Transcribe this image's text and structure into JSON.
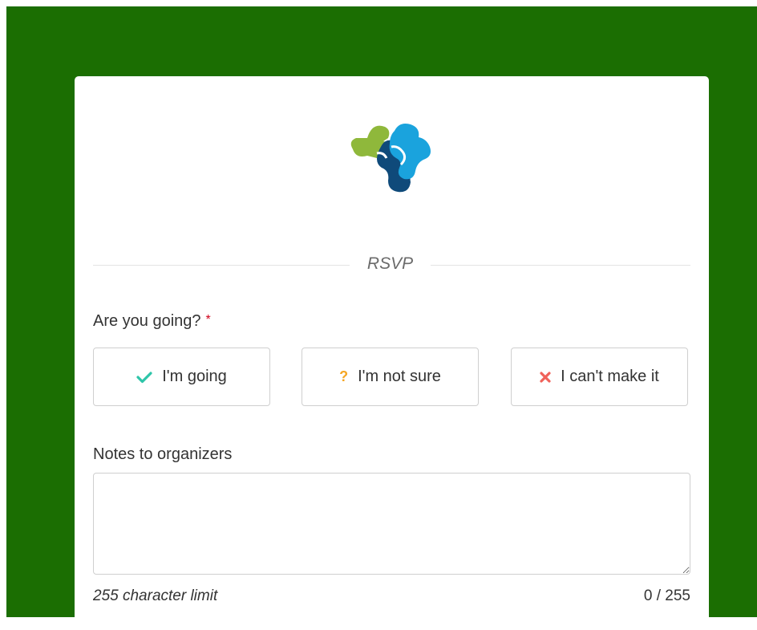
{
  "theme": {
    "background": "#1b6e02",
    "card": "#ffffff",
    "check_color": "#2ec5a9",
    "question_color": "#f5a623",
    "cross_color": "#f0625a",
    "required_color": "#d0021b"
  },
  "logo": {
    "icon": "puzzle-cross-logo",
    "colors": [
      "#8fb83b",
      "#1aa3dd",
      "#0f4a7a"
    ]
  },
  "section_title": "RSVP",
  "question": {
    "label": "Are you going?",
    "required_marker": "*"
  },
  "choices": [
    {
      "label": "I'm going",
      "icon": "check-icon",
      "glyph": "✔"
    },
    {
      "label": "I'm not sure",
      "icon": "question-icon",
      "glyph": "?"
    },
    {
      "label": "I can't make it",
      "icon": "cross-icon",
      "glyph": "✖"
    }
  ],
  "notes": {
    "label": "Notes to organizers",
    "value": "",
    "placeholder": "",
    "limit_text": "255 character limit",
    "counter": "0 / 255"
  }
}
